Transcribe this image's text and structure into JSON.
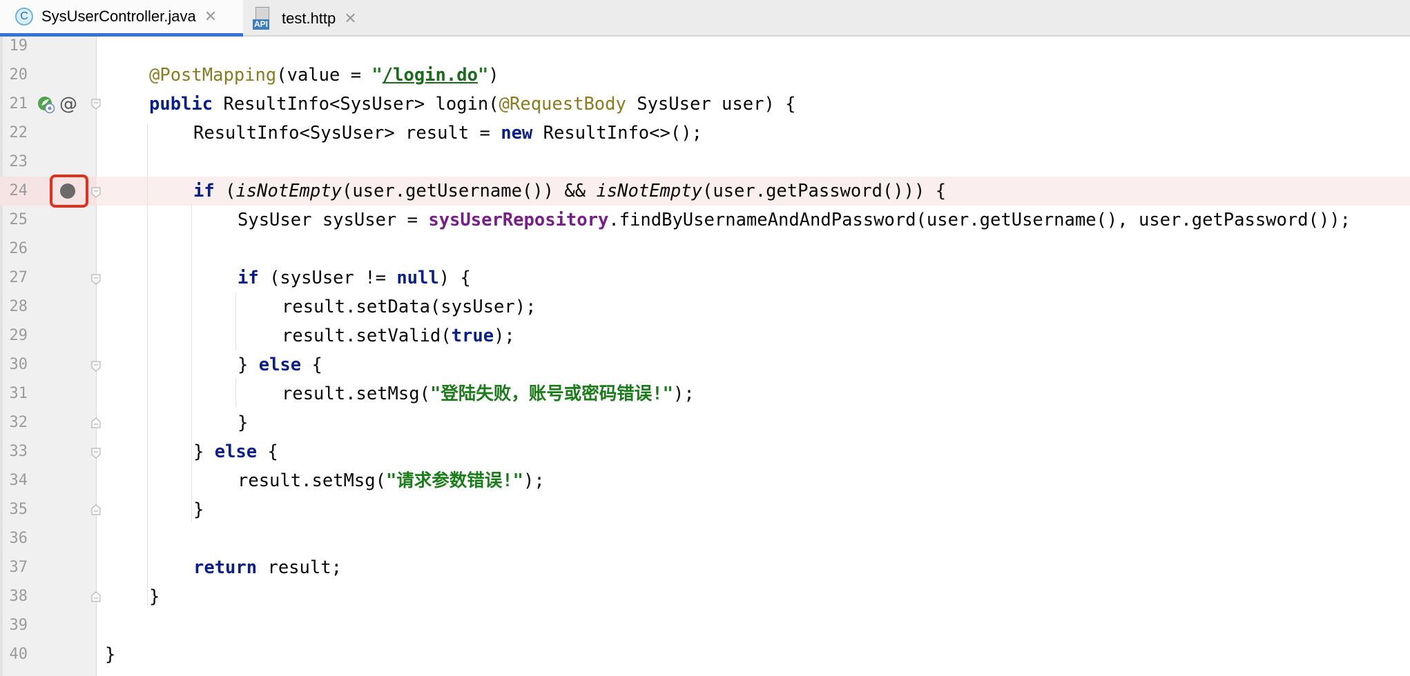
{
  "tabs": [
    {
      "label": "SysUserController.java",
      "icon": "class-c-icon",
      "icon_letter": "C",
      "active": true
    },
    {
      "label": "test.http",
      "icon": "api-file-icon",
      "icon_text": "API",
      "active": false
    }
  ],
  "close_glyph": "✕",
  "gutter_icons": {
    "line21_spring": "spring-bean-icon",
    "line21_at": "@",
    "line24_breakpoint": "breakpoint-icon"
  },
  "highlighted_line": 24,
  "lines": [
    {
      "n": "19"
    },
    {
      "n": "20"
    },
    {
      "n": "21"
    },
    {
      "n": "22"
    },
    {
      "n": "23"
    },
    {
      "n": "24"
    },
    {
      "n": "25"
    },
    {
      "n": "26"
    },
    {
      "n": "27"
    },
    {
      "n": "28"
    },
    {
      "n": "29"
    },
    {
      "n": "30"
    },
    {
      "n": "31"
    },
    {
      "n": "32"
    },
    {
      "n": "33"
    },
    {
      "n": "34"
    },
    {
      "n": "35"
    },
    {
      "n": "36"
    },
    {
      "n": "37"
    },
    {
      "n": "38"
    },
    {
      "n": "39"
    },
    {
      "n": "40"
    }
  ],
  "code": {
    "l20": {
      "ann": "@PostMapping",
      "a": "(value = ",
      "q1": "\"",
      "url": "/login.do",
      "q2": "\"",
      "b": ")"
    },
    "l21": {
      "kw": "public",
      "a": " ResultInfo<SysUser> login(",
      "ann": "@RequestBody",
      "b": " SysUser user) {"
    },
    "l22": {
      "a": "ResultInfo<SysUser> result = ",
      "kw": "new",
      "b": " ResultInfo<>();"
    },
    "l24": {
      "kw": "if",
      "a": " (",
      "f1": "isNotEmpty",
      "b": "(user.getUsername()) && ",
      "f2": "isNotEmpty",
      "c": "(user.getPassword())) {"
    },
    "l25": {
      "a": "SysUser sysUser = ",
      "fld": "sysUserRepository",
      "b": ".findByUsernameAndAndPassword(user.getUsername(), user.getPassword());"
    },
    "l27": {
      "kw": "if",
      "a": " (sysUser != ",
      "kw2": "null",
      "b": ") {"
    },
    "l28": {
      "a": "result.setData(sysUser);"
    },
    "l29": {
      "a": "result.setValid(",
      "kw": "true",
      "b": ");"
    },
    "l30": {
      "a": "} ",
      "kw": "else",
      "b": " {"
    },
    "l31": {
      "a": "result.setMsg(",
      "str": "\"登陆失败，账号或密码错误!\"",
      "b": ");"
    },
    "l32": {
      "a": "}"
    },
    "l33": {
      "a": "} ",
      "kw": "else",
      "b": " {"
    },
    "l34": {
      "a": "result.setMsg(",
      "str": "\"请求参数错误!\"",
      "b": ");"
    },
    "l35": {
      "a": "}"
    },
    "l37": {
      "kw": "return",
      "a": " result;"
    },
    "l38": {
      "a": "}"
    },
    "l40": {
      "a": "}"
    }
  }
}
